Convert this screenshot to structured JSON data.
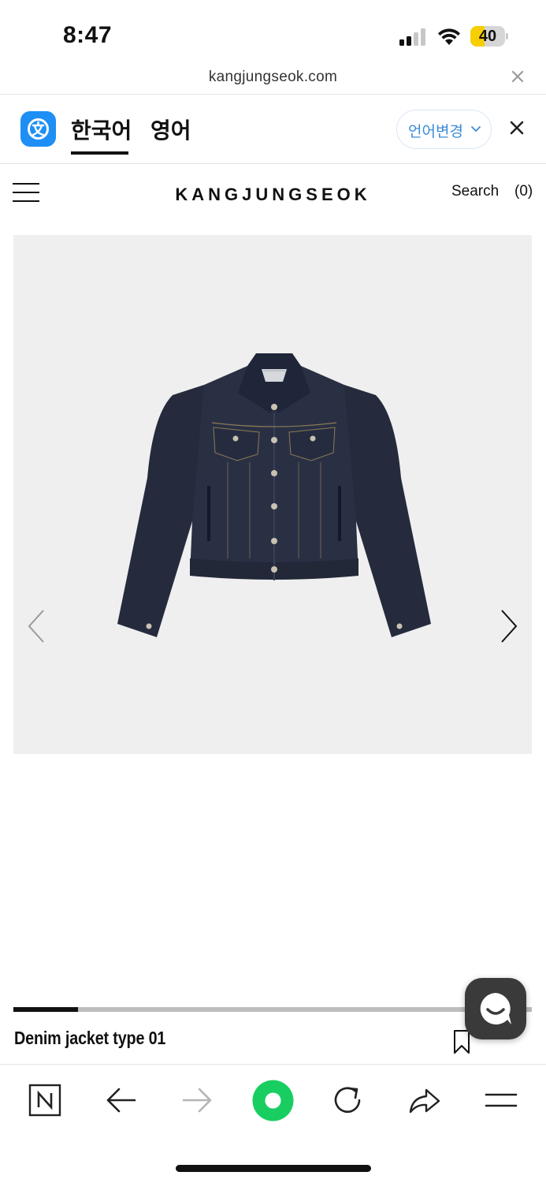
{
  "status_bar": {
    "time": "8:47",
    "battery_level": "40",
    "battery_fraction": 0.4,
    "battery_color": "#f7ce00"
  },
  "url_bar": {
    "url": "kangjungseok.com",
    "close_icon": "close-icon"
  },
  "translation_bar": {
    "app_icon": "papago-translate-icon",
    "tab_source": "한국어",
    "tab_target": "영어",
    "change_language_label": "언어변경",
    "accent": "#1e8ff5"
  },
  "site_header": {
    "logo": "KANGJUNGSEOK",
    "search_label": "Search",
    "cart_label": "(0)"
  },
  "product": {
    "name": "Denim jacket type 01",
    "image_alt": "Denim jacket",
    "image_background": "#efefef",
    "carousel_progress_fraction": 0.125
  },
  "toolbar": {
    "items": [
      "naver-icon",
      "back-arrow-icon",
      "forward-arrow-icon",
      "green-dot-home-icon",
      "reload-icon",
      "share-icon",
      "menu-icon"
    ],
    "home_color": "#19ce60"
  }
}
